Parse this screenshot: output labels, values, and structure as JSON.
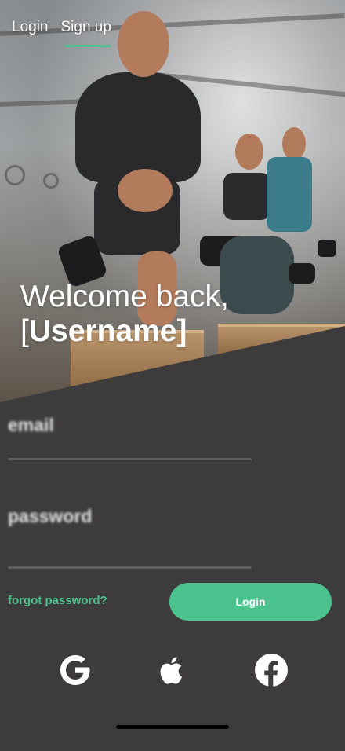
{
  "nav": {
    "tabs": [
      {
        "label": "Login"
      },
      {
        "label": "Sign up"
      }
    ],
    "active_tab": "Sign up"
  },
  "hero": {
    "welcome_line1": "Welcome back,",
    "username_open": "[",
    "username": "Username",
    "username_close": "]"
  },
  "form": {
    "email_label": "email",
    "password_label": "password",
    "forgot_label": "forgot password?",
    "login_label": "Login"
  },
  "social": {
    "icons": [
      "google-icon",
      "apple-icon",
      "facebook-icon"
    ]
  },
  "colors": {
    "accent": "#4bc38e",
    "background": "#3d3b3c",
    "text": "#ffffff"
  }
}
